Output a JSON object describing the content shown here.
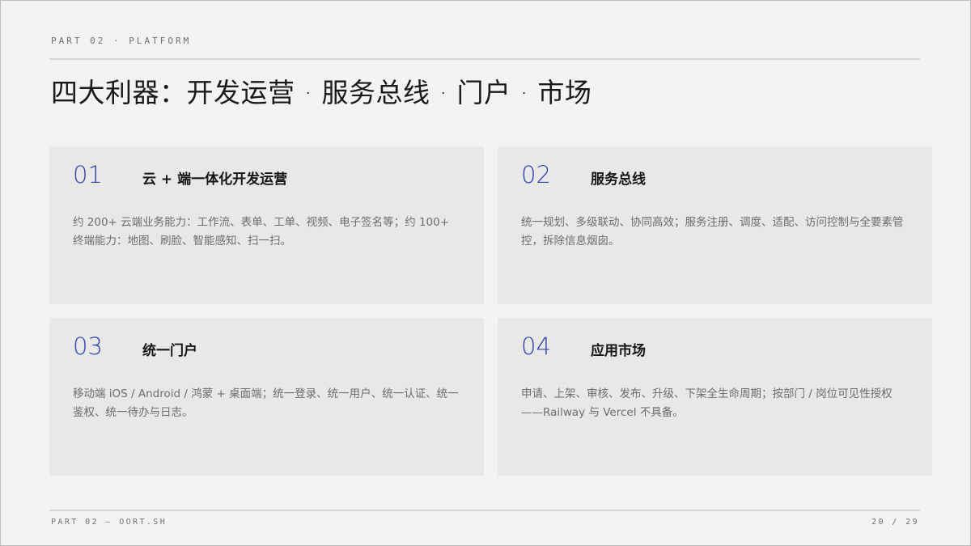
{
  "header": {
    "eyebrow": "PART 02 · PLATFORM",
    "title": "四大利器：开发运营 · 服务总线 · 门户 · 市场"
  },
  "cards": [
    {
      "number": "01",
      "heading": "云 + 端一体化开发运营",
      "body": "约 200+ 云端业务能力：工作流、表单、工单、视频、电子签名等；约 100+ 终端能力：地图、刷脸、智能感知、扫一扫。"
    },
    {
      "number": "02",
      "heading": "服务总线",
      "body": "统一规划、多级联动、协同高效；服务注册、调度、适配、访问控制与全要素管控，拆除信息烟囱。"
    },
    {
      "number": "03",
      "heading": "统一门户",
      "body": "移动端 iOS / Android / 鸿蒙 + 桌面端；统一登录、统一用户、统一认证、统一鉴权、统一待办与日志。"
    },
    {
      "number": "04",
      "heading": "应用市场",
      "body": "申请、上架、审核、发布、升级、下架全生命周期；按部门 / 岗位可见性授权——Railway 与 Vercel 不具备。"
    }
  ],
  "footer": {
    "left": "PART 02 — OORT.SH",
    "page": "20 / 29"
  },
  "colors": {
    "accent": "#2f44b5",
    "card_bg": "#e8e8e7",
    "page_bg": "#f3f3f2"
  }
}
